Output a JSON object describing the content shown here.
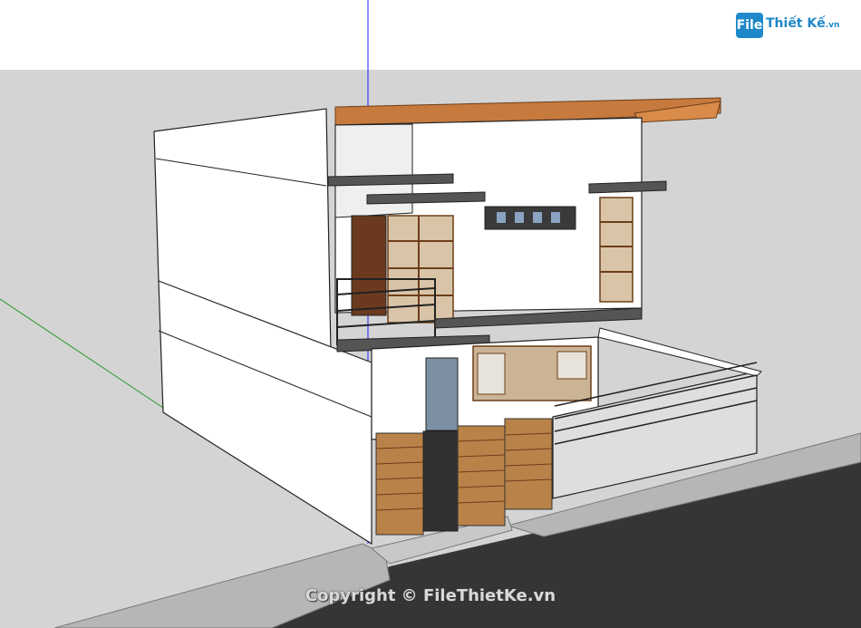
{
  "logo": {
    "file_text": "File",
    "rest_text": "Thiết Kế",
    "suffix": ".vn"
  },
  "watermark": {
    "text": "Copyright © FileThietKe.vn"
  },
  "colors": {
    "sky": "#ffffff",
    "ground": "#d4d4d4",
    "road": "#353535",
    "sidewalk": "#b8b8b8",
    "wall": "#ffffff",
    "wall_shade": "#e9e9e9",
    "roof": "#c77a3e",
    "wood": "#b98249",
    "dark": "#444444",
    "glass": "#8aa3c2",
    "axis_blue": "#1c1cff",
    "axis_green": "#1e9a1e"
  },
  "icons": {
    "logo": "filethietke-logo-icon"
  }
}
